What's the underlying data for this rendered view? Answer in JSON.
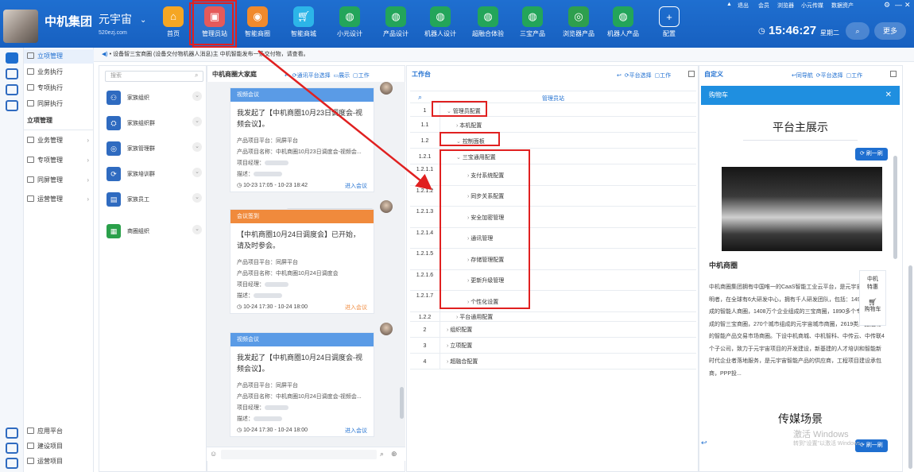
{
  "header": {
    "brand": "中机集团",
    "tenant": "元宇宙",
    "tenant_domain": "520ezj.com",
    "nav": [
      {
        "label": "首页",
        "icon": "home-icon",
        "color": "#f5a623"
      },
      {
        "label": "管理员站",
        "icon": "admin-icon",
        "color": "#e55a5a",
        "active": true
      },
      {
        "label": "智能商圈",
        "icon": "circle-icon",
        "color": "#f08a2c"
      },
      {
        "label": "智能商城",
        "icon": "cart-icon",
        "color": "#2cb5e8"
      },
      {
        "label": "小元设计",
        "icon": "globe-icon",
        "color": "#23a55a"
      },
      {
        "label": "产品设计",
        "icon": "globe-icon",
        "color": "#23a55a"
      },
      {
        "label": "机器人设计",
        "icon": "globe-icon",
        "color": "#23a55a"
      },
      {
        "label": "超融合体验",
        "icon": "globe-icon",
        "color": "#23a55a"
      },
      {
        "label": "三宝产品",
        "icon": "globe-icon",
        "color": "#23a55a"
      },
      {
        "label": "浏览器产品",
        "icon": "browser-icon",
        "color": "#2e9f4e"
      },
      {
        "label": "机器人产品",
        "icon": "globe-icon",
        "color": "#23a55a"
      },
      {
        "label": "配置",
        "icon": "plus-icon",
        "color": "#3a7fd6"
      }
    ],
    "utils": [
      "退出",
      "会员",
      "浏览器",
      "小元传媒",
      "数据资产"
    ],
    "time": "15:46:27",
    "weekday": "星期二",
    "more_label": "更多"
  },
  "notice": "• 设备智三宝商圈 (设备交付物机器人消息)主    中机智能发布一条交付物，请查看。",
  "leftnav": {
    "top_items": [
      {
        "label": "立项管理",
        "selected": true
      },
      {
        "label": "业务执行"
      },
      {
        "label": "专项执行"
      },
      {
        "label": "同屏执行"
      }
    ],
    "section_title": "立项管理",
    "groups": [
      {
        "label": "业务管理"
      },
      {
        "label": "专项管理"
      },
      {
        "label": "同屏管理"
      },
      {
        "label": "运营管理"
      }
    ],
    "bottom_items": [
      {
        "label": "应用平台"
      },
      {
        "label": "建设项目"
      },
      {
        "label": "运营项目"
      }
    ]
  },
  "org_panel": {
    "search_placeholder": "搜索",
    "items": [
      {
        "label": "家族组织",
        "color": "#2f6bc0"
      },
      {
        "label": "家族组织群",
        "color": "#2f6bc0"
      },
      {
        "label": "家族管理群",
        "color": "#2f6bc0"
      },
      {
        "label": "家族培训群",
        "color": "#2f6bc0"
      },
      {
        "label": "家族员工",
        "color": "#2f6bc0"
      },
      {
        "label": "商圈组织",
        "color": "#2aa04a"
      }
    ]
  },
  "chat_panel": {
    "title": "中机商圈大家庭",
    "tools": [
      "通讯平台选择",
      "展示",
      "工作"
    ],
    "cards": [
      {
        "type": "视频会议",
        "type_color": "#5a9be6",
        "message": "我发起了【中机商圈10月23日调度会-视频会议】。",
        "platform": "产品项目平台：同屏平台",
        "project": "产品项目名称：中机商圈10月23日调度会-视频会...",
        "manager": "项目经理：",
        "desc": "描述：",
        "time": "10-23 17:05 - 10-23 18:42",
        "action": "进入会议",
        "action_color": "#1f6fd0"
      },
      {
        "type": "会议签到",
        "type_color": "#f08a3c",
        "message": "【中机商圈10月24日调度会】已开始，请及时参会。",
        "platform": "产品项目平台：同屏平台",
        "project": "产品项目名称：中机商圈10月24日调度会",
        "manager": "项目经理：",
        "desc": "描述：",
        "time": "10-24 17:30 - 10-24 18:00",
        "action": "进入会议",
        "action_color": "#f08a3c"
      },
      {
        "type": "视频会议",
        "type_color": "#5a9be6",
        "message": "我发起了【中机商圈10月24日调度会-视频会议】。",
        "platform": "产品项目平台：同屏平台",
        "project": "产品项目名称：中机商圈10月24日调度会-视频会...",
        "manager": "项目经理：",
        "desc": "描述：",
        "time": "10-24 17:30 - 10-24 18:00",
        "action": "进入会议",
        "action_color": "#1f6fd0"
      }
    ]
  },
  "work_panel": {
    "title": "工作台",
    "tools": [
      "平台选择",
      "工作"
    ],
    "column_header": "管理员站",
    "rows": [
      {
        "num": "1",
        "label": "管理员配置",
        "indent": 0,
        "open": true
      },
      {
        "num": "1.1",
        "label": "本机配置",
        "indent": 1,
        "open": false
      },
      {
        "num": "1.2",
        "label": "控制面板",
        "indent": 1,
        "open": true
      },
      {
        "num": "1.2.1",
        "label": "三宝通用配置",
        "indent": 2,
        "open": true
      },
      {
        "num": "1.2.1.1",
        "label": "支付系统配置",
        "indent": 3,
        "open": false
      },
      {
        "num": "1.2.1.2",
        "label": "同步关系配置",
        "indent": 3,
        "open": false
      },
      {
        "num": "1.2.1.3",
        "label": "安全加密管理",
        "indent": 3,
        "open": false
      },
      {
        "num": "1.2.1.4",
        "label": "通讯管理",
        "indent": 3,
        "open": false
      },
      {
        "num": "1.2.1.5",
        "label": "存储管理配置",
        "indent": 3,
        "open": false
      },
      {
        "num": "1.2.1.6",
        "label": "更新升级管理",
        "indent": 3,
        "open": false
      },
      {
        "num": "1.2.1.7",
        "label": "个性化设置",
        "indent": 3,
        "open": false
      },
      {
        "num": "1.2.2",
        "label": "平台通用配置",
        "indent": 2,
        "open": false
      },
      {
        "num": "2",
        "label": "组织配置",
        "indent": 0,
        "open": false
      },
      {
        "num": "3",
        "label": "立项配置",
        "indent": 0,
        "open": false
      },
      {
        "num": "4",
        "label": "超融合配置",
        "indent": 0,
        "open": false
      }
    ]
  },
  "custom_panel": {
    "title": "自定义",
    "tools": [
      "同导航",
      "平台选择",
      "工作"
    ],
    "tab": "购物车",
    "heading": "平台主展示",
    "refresh_label": "刷一刷",
    "intro_title": "中机商圈",
    "intro_text": "中机商圈集团拥有中国唯一的CaaS智能工业云平台，是元宇宙技术的发明者，在全球有6大研发中心，拥有千人研发团队，包括：1495万人组成的智能人商圈，1408万个企业组成的三宝商圈，1890多个专业企业组成的智三宝商圈，270个城市组成的元宇宙城市商圈，2619类产品组成的智能产品交易市场商圈。下设中机商城、中机智科、中传云、中传联4个子公司，致力于元宇宙项目的开发建设，新基建的人才培训和智能新时代企业者落地服务，是元宇宙智能产品的供应商，工程项目建设承包商，PPP投...",
    "side_labels": [
      "中机特惠",
      "购物车"
    ],
    "sub_heading": "传媒场景",
    "watermark_1": "激活 Windows",
    "watermark_2": "转到\"设置\"以激活 Windows。"
  },
  "colors": {
    "primary": "#1f6fd0",
    "highlight": "#e02020",
    "orange": "#f08a3c"
  }
}
